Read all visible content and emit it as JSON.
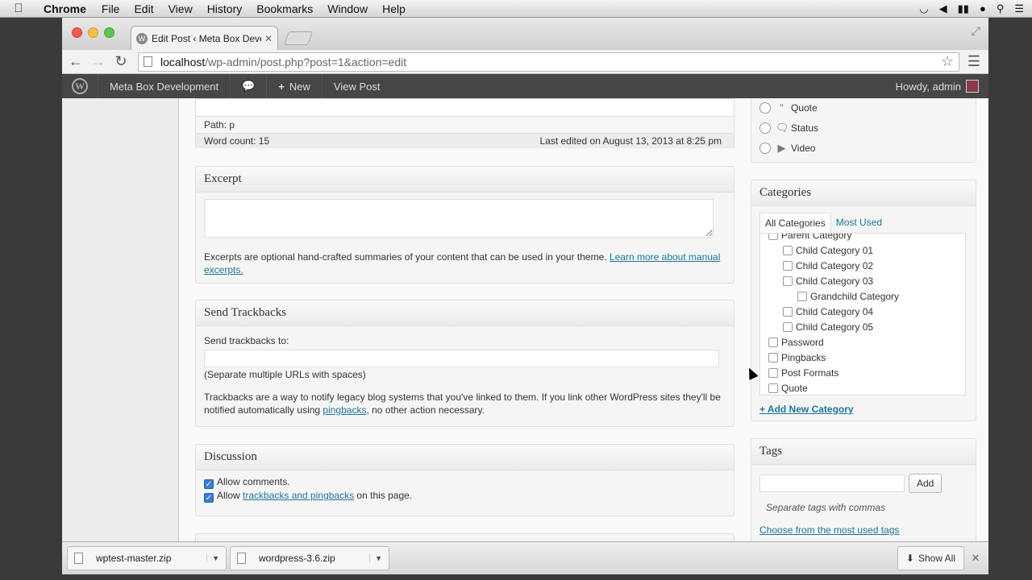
{
  "mac_menu": {
    "app": "Chrome",
    "items": [
      "File",
      "Edit",
      "View",
      "History",
      "Bookmarks",
      "Window",
      "Help"
    ]
  },
  "browser": {
    "tab_title": "Edit Post ‹ Meta Box Develc",
    "url_host": "localhost",
    "url_path": "/wp-admin/post.php?post=1&action=edit"
  },
  "adminbar": {
    "site_name": "Meta Box Development",
    "new_label": "New",
    "view_post_label": "View Post",
    "howdy": "Howdy, admin"
  },
  "editor": {
    "path_label": "Path: p",
    "word_count": "Word count: 15",
    "last_edited": "Last edited on August 13, 2013 at 8:25 pm"
  },
  "excerpt": {
    "title": "Excerpt",
    "help_text": "Excerpts are optional hand-crafted summaries of your content that can be used in your theme.",
    "link_text": "Learn more about manual excerpts."
  },
  "trackbacks": {
    "title": "Send Trackbacks",
    "label": "Send trackbacks to:",
    "hint": "(Separate multiple URLs with spaces)",
    "help_before": "Trackbacks are a way to notify legacy blog systems that you've linked to them. If you link other WordPress sites they'll be notified automatically using ",
    "help_link": "pingbacks",
    "help_after": ", no other action necessary."
  },
  "discussion": {
    "title": "Discussion",
    "allow_comments": "Allow comments.",
    "allow_prefix": "Allow ",
    "allow_link": "trackbacks and pingbacks",
    "allow_suffix": " on this page."
  },
  "formats": {
    "items": [
      "Quote",
      "Status",
      "Video"
    ]
  },
  "categories": {
    "title": "Categories",
    "tab_all": "All Categories",
    "tab_most": "Most Used",
    "items": [
      {
        "label": "Parent Category",
        "level": 0
      },
      {
        "label": "Child Category 01",
        "level": 1
      },
      {
        "label": "Child Category 02",
        "level": 1
      },
      {
        "label": "Child Category 03",
        "level": 1
      },
      {
        "label": "Grandchild Category",
        "level": 2
      },
      {
        "label": "Child Category 04",
        "level": 1
      },
      {
        "label": "Child Category 05",
        "level": 1
      },
      {
        "label": "Password",
        "level": 0
      },
      {
        "label": "Pingbacks",
        "level": 0
      },
      {
        "label": "Post Formats",
        "level": 0
      },
      {
        "label": "Quote",
        "level": 0
      }
    ],
    "add_new": "+ Add New Category"
  },
  "tags": {
    "title": "Tags",
    "add_button": "Add",
    "hint": "Separate tags with commas",
    "choose_link": "Choose from the most used tags"
  },
  "downloads": {
    "files": [
      "wptest-master.zip",
      "wordpress-3.6.zip"
    ],
    "show_all": "Show All"
  }
}
